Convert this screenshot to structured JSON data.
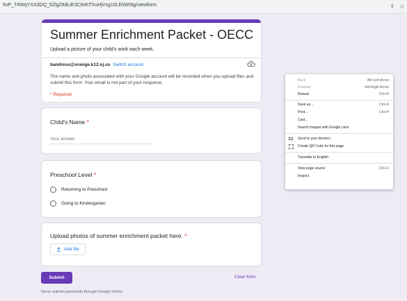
{
  "browser": {
    "url": "5vP_T4WqYXX3DQ_5ZlgZ8dLiE3C64hTXuHjVsg10LEkW3tg/viewform",
    "icons": [
      "share-icon",
      "bookmark-star-icon"
    ]
  },
  "form": {
    "title": "Summer Enrichment Packet - OECC",
    "description": "Upload a picture of your child's work each week.",
    "email": "bandress@orange.k12.nj.us",
    "switch_account": "Switch account",
    "notice": "The name and photo associated with your Google account will be recorded when you upload files and submit this form. Your email is not part of your response.",
    "required_note": "* Required"
  },
  "questions": [
    {
      "title": "Child's Name",
      "required_mark": "*",
      "placeholder": "Your answer"
    },
    {
      "title": "Preschool Level",
      "required_mark": "*",
      "options": [
        "Returning to Preschool",
        "Going to Kindergarten"
      ]
    },
    {
      "title": "Upload photos of summer enrichment packet here.",
      "required_mark": "*",
      "add_file_label": "Add file",
      "add_file_icon": "upload-icon"
    }
  ],
  "actions": {
    "submit": "Submit",
    "clear": "Clear form",
    "footer": "Never submit passwords through Google Forms."
  },
  "context_menu": {
    "items": [
      {
        "label": "Back",
        "shortcut": "Alt+Left Arrow"
      },
      {
        "label": "Forward",
        "shortcut": "Alt+Right Arrow"
      },
      {
        "label": "Reload",
        "shortcut": "Ctrl+R"
      },
      {
        "label": "Save as...",
        "shortcut": "Ctrl+S"
      },
      {
        "label": "Print...",
        "shortcut": "Ctrl+P"
      },
      {
        "label": "Cast...",
        "shortcut": ""
      },
      {
        "label": "Search images with Google Lens",
        "shortcut": ""
      },
      {
        "label": "Send to your devices",
        "shortcut": "",
        "icon": "send-to-devices-icon"
      },
      {
        "label": "Create QR Code for this page",
        "shortcut": "",
        "icon": "qr-code-icon"
      },
      {
        "label": "Translate to English",
        "shortcut": ""
      },
      {
        "label": "View page source",
        "shortcut": "Ctrl+U"
      },
      {
        "label": "Inspect",
        "shortcut": ""
      }
    ]
  },
  "colors": {
    "accent": "#673ab7",
    "background": "#efebf5",
    "link": "#1a73e8",
    "required": "#d93025"
  }
}
